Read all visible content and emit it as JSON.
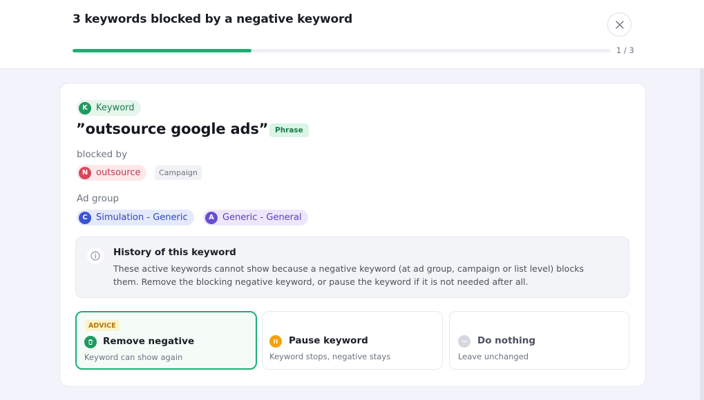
{
  "header": {
    "title": "3 keywords blocked by a negative keyword",
    "progress_fraction": 0.333,
    "progress_label": "1 / 3",
    "close_icon": "close-icon"
  },
  "keyword": {
    "chip_letter": "K",
    "chip_label": "Keyword",
    "text": "”outsource google ads”",
    "match_type": "Phrase"
  },
  "blocked_by": {
    "label": "blocked by",
    "chip_letter": "N",
    "negative": "outsource",
    "level": "Campaign"
  },
  "ad_group": {
    "label": "Ad group",
    "items": [
      {
        "letter": "C",
        "name": "Simulation - Generic"
      },
      {
        "letter": "A",
        "name": "Generic - General"
      }
    ]
  },
  "info": {
    "icon": "info-icon",
    "title": "History of this keyword",
    "body": "These active keywords cannot show because a negative keyword (at ad group, campaign or list level) blocks them. Remove the blocking negative keyword, or pause the keyword if it is not needed after all."
  },
  "options": [
    {
      "badge": "ADVICE",
      "title": "Remove negative",
      "subtitle": "Keyword can show again",
      "icon": "trash-icon",
      "selected": true
    },
    {
      "title": "Pause keyword",
      "subtitle": "Keyword stops, negative stays",
      "icon": "pause-icon",
      "selected": false
    },
    {
      "title": "Do nothing",
      "subtitle": "Leave unchanged",
      "icon": "minus-icon",
      "selected": false
    }
  ],
  "colors": {
    "accent_green": "#1aae73",
    "negative_red": "#d8475b",
    "pause_orange": "#f2a20c",
    "campaign_blue": "#3a55d0",
    "adgroup_purple": "#6a4fd0"
  }
}
